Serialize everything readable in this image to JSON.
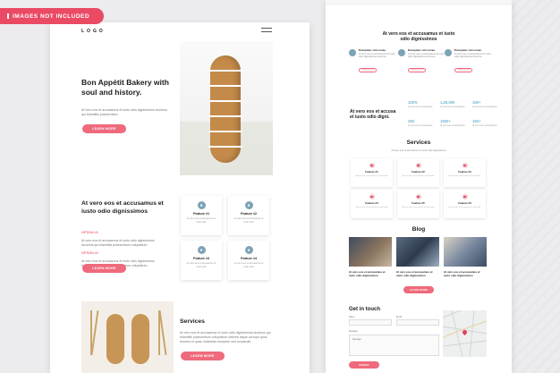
{
  "badge": {
    "text": "IMAGES NOT INCLUDED"
  },
  "page1": {
    "logo": "LOGO",
    "hero": {
      "title": "Bon Appétit Bakery with soul and history.",
      "subtitle": "At vero eos et accusamus et iusto odio dignissimos ducimus qui blanditiis praesentium.",
      "button": "LEARN MORE"
    },
    "about": {
      "title": "At vero eos et accusamus et iusto odio dignissimos",
      "options": [
        {
          "label": "OPTION #1",
          "text": "At vero eos et accusamus et iusto odio dignissimos ducimus qui blanditiis praesentium voluptatum"
        },
        {
          "label": "OPTION #2",
          "text": "At vero eos et accusamus et iusto odio dignissimos ducimus qui blanditiis praesentium voluptatum"
        }
      ],
      "button": "LEARN MORE",
      "features": [
        {
          "title": "Feature #1",
          "text": "At vero eos et accusamus et iusto odio"
        },
        {
          "title": "Feature #2",
          "text": "At vero eos et accusamus et iusto odio"
        },
        {
          "title": "Feature #3",
          "text": "At vero eos et accusamus et iusto odio"
        },
        {
          "title": "Feature #4",
          "text": "At vero eos et accusamus et iusto odio"
        }
      ]
    },
    "services": {
      "title": "Services",
      "text": "At vero eos et accusamus et iusto odio dignissimos ducimus qui blanditiis praesentium voluptatum deleniti atque corrupti quos dolores et quas molestias excepturi sint occaecati.",
      "button": "LEARN MORE"
    }
  },
  "page2": {
    "top": {
      "title": "At vero eos et accusamus et iusto odio dignissimos",
      "cols": [
        {
          "title": "Excepteur sint occae",
          "text": "At vero eos et accusamus et iusto odio dignissimos ducimus",
          "button": "LEARN MORE"
        },
        {
          "title": "Excepteur sint occae",
          "text": "At vero eos et accusamus et iusto odio dignissimos ducimus",
          "button": "LEARN MORE"
        },
        {
          "title": "Excepteur sint occae",
          "text": "At vero eos et accusamus et iusto odio dignissimos ducimus",
          "button": "LEARN MORE"
        }
      ]
    },
    "stats": {
      "title": "At vero eos et accusa et iusto odio digni.",
      "items": [
        {
          "value": "100%",
          "label": "At vero eos et accusamus"
        },
        {
          "value": "1,00,000",
          "label": "At vero eos et accusamus"
        },
        {
          "value": "100+",
          "label": "At vero eos et accusamus"
        },
        {
          "value": "250",
          "label": "At vero eos et accusamus"
        },
        {
          "value": "1500+",
          "label": "At vero eos et accusamus"
        },
        {
          "value": "150+",
          "label": "At vero eos et accusamus"
        }
      ]
    },
    "services": {
      "title": "Services",
      "subtitle": "At vero eos et accusamus et iusto odio dignissimos",
      "features": [
        {
          "title": "Feature #1",
          "text": "At vero eos et accusamus et iusto odio"
        },
        {
          "title": "Feature #2",
          "text": "At vero eos et accusamus et iusto odio"
        },
        {
          "title": "Feature #3",
          "text": "At vero eos et accusamus et iusto odio"
        },
        {
          "title": "Feature #4",
          "text": "At vero eos et accusamus et iusto odio"
        },
        {
          "title": "Feature #5",
          "text": "At vero eos et accusamus et iusto odio"
        },
        {
          "title": "Feature #6",
          "text": "At vero eos et accusamus et iusto odio"
        }
      ]
    },
    "blog": {
      "title": "Blog",
      "posts": [
        {
          "text": "At vero eos et accusamus et iusto odio dignissimos."
        },
        {
          "text": "At vero eos et accusamus et iusto odio dignissimos."
        },
        {
          "text": "At vero eos et accusamus et iusto odio dignissimos."
        }
      ],
      "button": "LEARN MORE"
    },
    "contact": {
      "title": "Get in touch",
      "name_label": "Name",
      "email_label": "Email",
      "message_label": "Message",
      "message_placeholder": "Message",
      "button": "SUBMIT"
    }
  }
}
